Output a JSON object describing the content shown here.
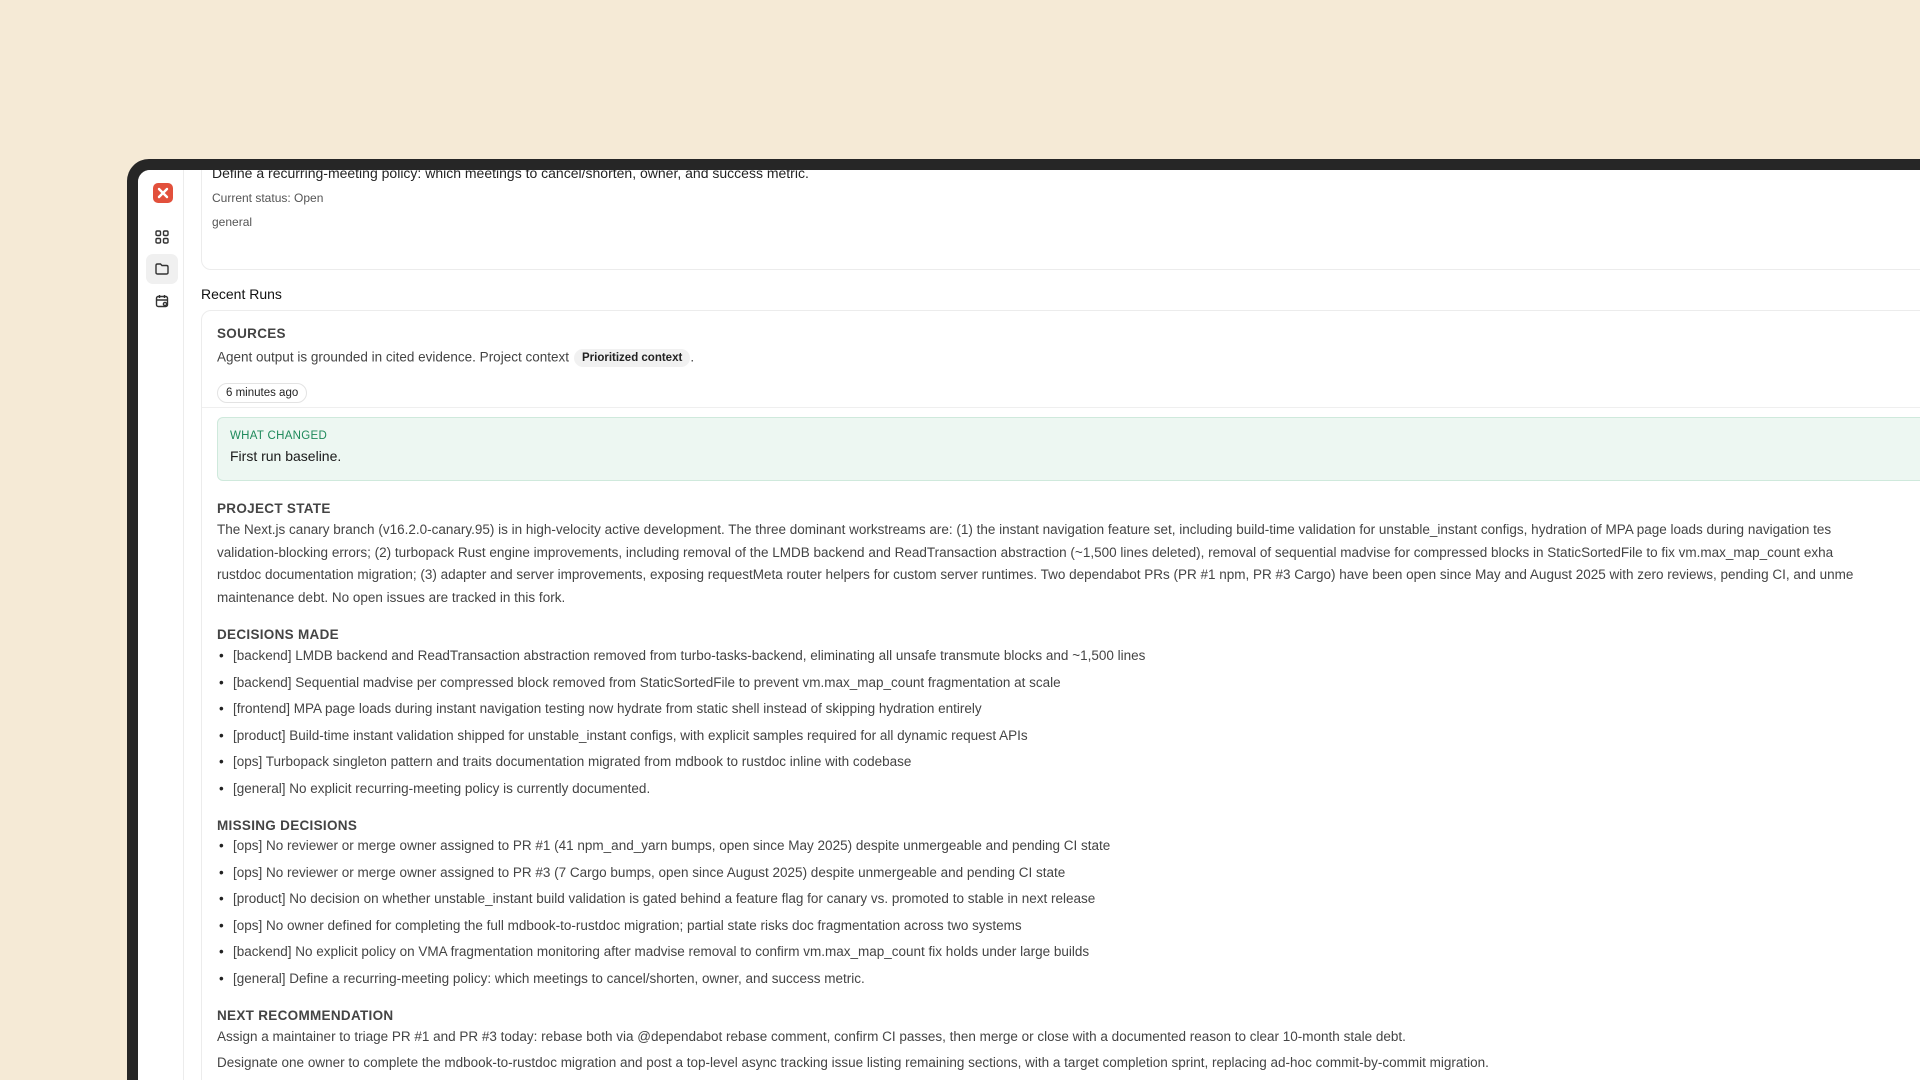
{
  "top_card": {
    "cut_text": "Define a recurring-meeting policy: which meetings to cancel/shorten, owner, and success metric.",
    "status": "Current status: Open",
    "tag": "general"
  },
  "rail": {
    "icons": [
      "app-logo-icon",
      "grid-icon",
      "folder-icon",
      "calendar-icon"
    ]
  },
  "recent_runs": {
    "title": "Recent Runs",
    "sources_label": "SOURCES",
    "sources_text": "Agent output is grounded in cited evidence. Project context",
    "sources_chip": "Prioritized context",
    "sources_end": ".",
    "time": "6 minutes ago",
    "what_changed_label": "WHAT CHANGED",
    "what_changed_text": "First run baseline.",
    "project_state_label": "PROJECT STATE",
    "project_state_lines": [
      "The Next.js canary branch (v16.2.0-canary.95) is in high-velocity active development. The three dominant workstreams are: (1) the instant navigation feature set, including build-time validation for unstable_instant configs, hydration of MPA page loads during navigation tes",
      "validation-blocking errors; (2) turbopack Rust engine improvements, including removal of the LMDB backend and ReadTransaction abstraction (~1,500 lines deleted), removal of sequential madvise for compressed blocks in StaticSortedFile to fix vm.max_map_count exha",
      "rustdoc documentation migration; (3) adapter and server improvements, exposing requestMeta router helpers for custom server runtimes. Two dependabot PRs (PR #1 npm, PR #3 Cargo) have been open since May and August 2025 with zero reviews, pending CI, and unme",
      "maintenance debt. No open issues are tracked in this fork."
    ],
    "decisions_label": "DECISIONS MADE",
    "decisions": [
      "[backend] LMDB backend and ReadTransaction abstraction removed from turbo-tasks-backend, eliminating all unsafe transmute blocks and ~1,500 lines",
      "[backend] Sequential madvise per compressed block removed from StaticSortedFile to prevent vm.max_map_count fragmentation at scale",
      "[frontend] MPA page loads during instant navigation testing now hydrate from static shell instead of skipping hydration entirely",
      "[product] Build-time instant validation shipped for unstable_instant configs, with explicit samples required for all dynamic request APIs",
      "[ops] Turbopack singleton pattern and traits documentation migrated from mdbook to rustdoc inline with codebase",
      "[general] No explicit recurring-meeting policy is currently documented."
    ],
    "missing_label": "MISSING DECISIONS",
    "missing": [
      "[ops] No reviewer or merge owner assigned to PR #1 (41 npm_and_yarn bumps, open since May 2025) despite unmergeable and pending CI state",
      "[ops] No reviewer or merge owner assigned to PR #3 (7 Cargo bumps, open since August 2025) despite unmergeable and pending CI state",
      "[product] No decision on whether unstable_instant build validation is gated behind a feature flag for canary vs. promoted to stable in next release",
      "[ops] No owner defined for completing the full mdbook-to-rustdoc migration; partial state risks doc fragmentation across two systems",
      "[backend] No explicit policy on VMA fragmentation monitoring after madvise removal to confirm vm.max_map_count fix holds under large builds",
      "[general] Define a recurring-meeting policy: which meetings to cancel/shorten, owner, and success metric."
    ],
    "next_label": "NEXT RECOMMENDATION",
    "next_lines": [
      "Assign a maintainer to triage PR #1 and PR #3 today: rebase both via @dependabot rebase comment, confirm CI passes, then merge or close with a documented reason to clear 10-month stale debt.",
      "Designate one owner to complete the mdbook-to-rustdoc migration and post a top-level async tracking issue listing remaining sections, with a target completion sprint, replacing ad-hoc commit-by-commit migration."
    ]
  },
  "colors": {
    "background": "#f5ead6",
    "accent_green": "#1f8a5b",
    "logo_red": "#e2503c"
  }
}
